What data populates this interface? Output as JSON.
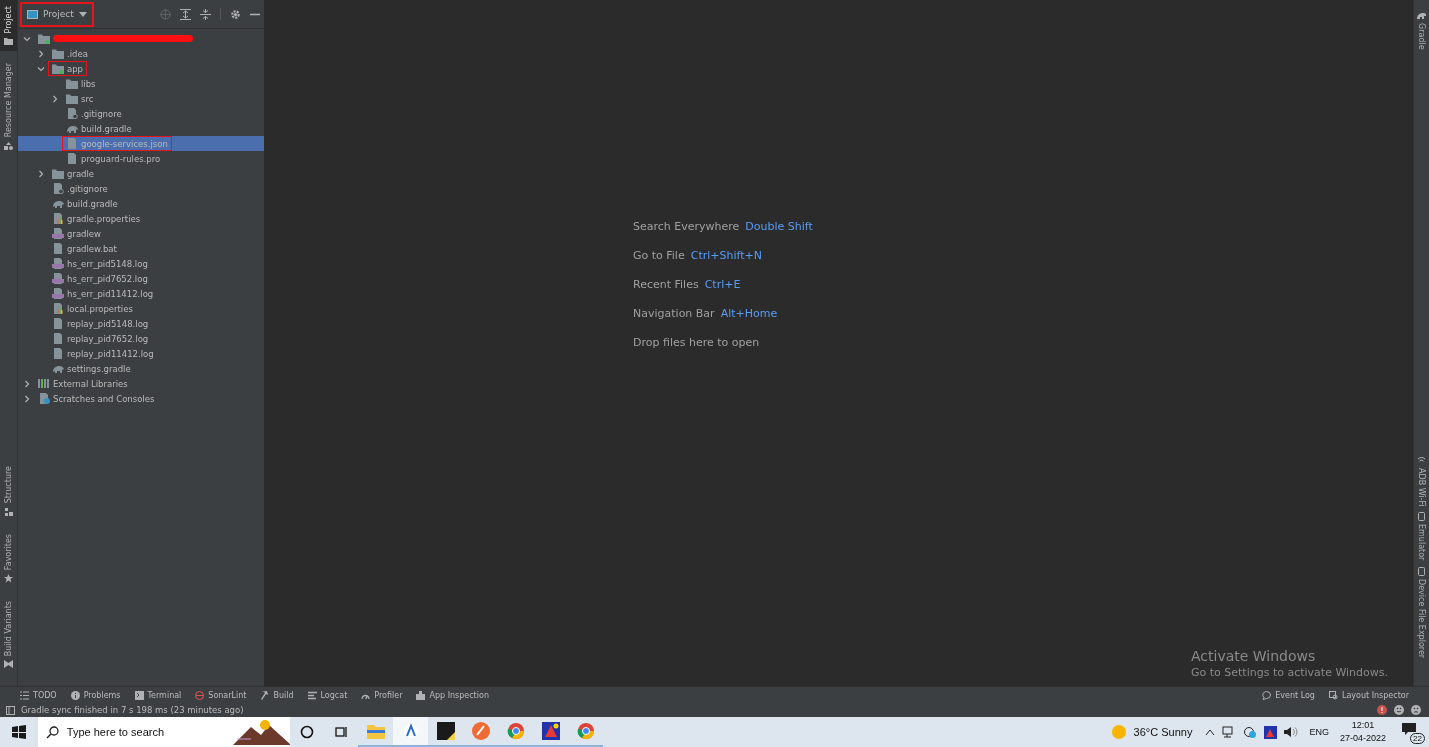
{
  "left_strip": {
    "top": [
      {
        "label": "Project",
        "kind": "folder",
        "selected": true
      },
      {
        "label": "Resource Manager",
        "kind": "shapes",
        "selected": false
      }
    ],
    "bottom": [
      {
        "label": "Structure",
        "kind": "structure",
        "selected": false
      },
      {
        "label": "Favorites",
        "kind": "star",
        "selected": false
      },
      {
        "label": "Build Variants",
        "kind": "variants",
        "selected": false
      }
    ]
  },
  "project_panel": {
    "title": "Project",
    "highlighted": true,
    "tree": [
      {
        "kind": "module",
        "redacted": true,
        "expanded": true,
        "selected": false,
        "highlighted": false,
        "children": [
          {
            "label": ".idea",
            "kind": "folder",
            "expanded": false,
            "selected": false,
            "highlighted": false
          },
          {
            "label": "app",
            "kind": "module",
            "expanded": true,
            "selected": false,
            "highlighted": true,
            "children": [
              {
                "label": "libs",
                "kind": "folder",
                "selected": false,
                "highlighted": false
              },
              {
                "label": "src",
                "kind": "folder",
                "expanded": false,
                "selected": false,
                "highlighted": false
              },
              {
                "label": ".gitignore",
                "kind": "ignore",
                "selected": false,
                "highlighted": false
              },
              {
                "label": "build.gradle",
                "kind": "gradle",
                "selected": false,
                "highlighted": false
              },
              {
                "label": "google-services.json",
                "kind": "json",
                "selected": true,
                "highlighted": true
              },
              {
                "label": "proguard-rules.pro",
                "kind": "file",
                "selected": false,
                "highlighted": false
              }
            ]
          },
          {
            "label": "gradle",
            "kind": "folder",
            "expanded": false,
            "selected": false,
            "highlighted": false
          },
          {
            "label": ".gitignore",
            "kind": "ignore",
            "selected": false,
            "highlighted": false
          },
          {
            "label": "build.gradle",
            "kind": "gradle",
            "selected": false,
            "highlighted": false
          },
          {
            "label": "gradle.properties",
            "kind": "properties",
            "selected": false,
            "highlighted": false
          },
          {
            "label": "gradlew",
            "kind": "script",
            "selected": false,
            "highlighted": false
          },
          {
            "label": "gradlew.bat",
            "kind": "file",
            "selected": false,
            "highlighted": false
          },
          {
            "label": "hs_err_pid5148.log",
            "kind": "script",
            "selected": false,
            "highlighted": false
          },
          {
            "label": "hs_err_pid7652.log",
            "kind": "script",
            "selected": false,
            "highlighted": false
          },
          {
            "label": "hs_err_pid11412.log",
            "kind": "script",
            "selected": false,
            "highlighted": false
          },
          {
            "label": "local.properties",
            "kind": "properties",
            "selected": false,
            "highlighted": false
          },
          {
            "label": "replay_pid5148.log",
            "kind": "file",
            "selected": false,
            "highlighted": false
          },
          {
            "label": "replay_pid7652.log",
            "kind": "file",
            "selected": false,
            "highlighted": false
          },
          {
            "label": "replay_pid11412.log",
            "kind": "file",
            "selected": false,
            "highlighted": false
          },
          {
            "label": "settings.gradle",
            "kind": "gradle",
            "selected": false,
            "highlighted": false
          }
        ]
      },
      {
        "label": "External Libraries",
        "kind": "library",
        "expanded": false,
        "selected": false,
        "highlighted": false
      },
      {
        "label": "Scratches and Consoles",
        "kind": "scratches",
        "expanded": false,
        "selected": false,
        "highlighted": false
      }
    ]
  },
  "editor_hints": [
    {
      "action": "Search Everywhere",
      "shortcut": "Double Shift"
    },
    {
      "action": "Go to File",
      "shortcut": "Ctrl+Shift+N"
    },
    {
      "action": "Recent Files",
      "shortcut": "Ctrl+E"
    },
    {
      "action": "Navigation Bar",
      "shortcut": "Alt+Home"
    },
    {
      "action": "Drop files here to open"
    }
  ],
  "activation_notice": {
    "title": "Activate Windows",
    "text": "Go to Settings to activate Windows."
  },
  "right_strip": [
    {
      "label": "Gradle",
      "kind": "gradle"
    },
    {
      "label": "ADB Wi-Fi",
      "kind": "wifi"
    },
    {
      "label": "Emulator",
      "kind": "emulator"
    },
    {
      "label": "Device File Explorer",
      "kind": "device"
    }
  ],
  "tool_tabs": [
    {
      "label": "TODO",
      "kind": "list"
    },
    {
      "label": "Problems",
      "kind": "info"
    },
    {
      "label": "Terminal",
      "kind": "terminal"
    },
    {
      "label": "SonarLint",
      "kind": "sonar"
    },
    {
      "label": "Build",
      "kind": "hammer"
    },
    {
      "label": "Logcat",
      "kind": "lines"
    },
    {
      "label": "Profiler",
      "kind": "gauge"
    },
    {
      "label": "App Inspection",
      "kind": "inspect"
    }
  ],
  "tool_tabs_right": [
    {
      "label": "Event Log",
      "kind": "bubble"
    },
    {
      "label": "Layout Inspector",
      "kind": "inspect-layout"
    }
  ],
  "status_bar": {
    "message": "Gradle sync finished in 7 s 198 ms (23 minutes ago)"
  },
  "taskbar": {
    "search_placeholder": "Type here to search",
    "apps": [
      {
        "kind": "explorer",
        "selected": false
      },
      {
        "kind": "studio",
        "selected": true
      },
      {
        "kind": "notes",
        "selected": false
      },
      {
        "kind": "compass",
        "selected": false
      },
      {
        "kind": "browser",
        "selected": false
      },
      {
        "kind": "paint",
        "selected": false
      },
      {
        "kind": "browser",
        "selected": false
      }
    ],
    "weather": "36°C  Sunny",
    "language": "ENG",
    "time": "12:01",
    "date": "27-04-2022",
    "notifications": "22"
  }
}
